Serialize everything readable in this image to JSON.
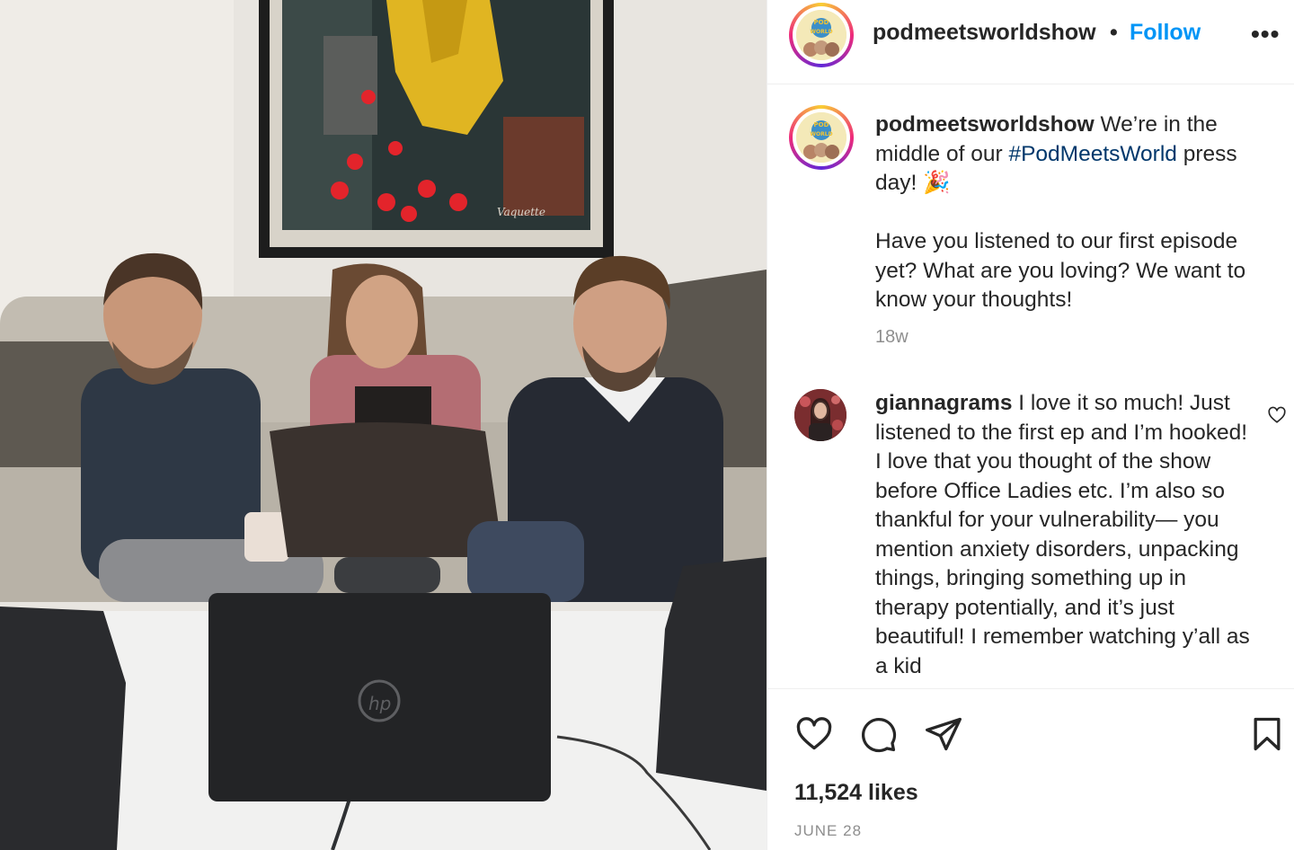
{
  "post": {
    "username": "podmeetsworldshow",
    "separator": "•",
    "follow_label": "Follow",
    "more_label": "•••",
    "avatar_text_top": "POD",
    "avatar_text_bottom": "WORLD"
  },
  "photo": {
    "painting_signature": "Vaquette"
  },
  "caption": {
    "username": "podmeetsworldshow",
    "text_1": " We’re in the middle of our ",
    "hashtag": "#PodMeetsWorld",
    "text_2": " press day! 🎉",
    "text_3": "Have you listened to our first episode yet? What are you loving? We want to know your thoughts!",
    "time": "18w"
  },
  "comment": {
    "username": "giannagrams",
    "text": " I love it so much! Just listened to the first ep and I’m hooked! I love that you thought of the show before Office Ladies etc. I’m also so thankful for your vulnerability— you mention anxiety disorders, unpacking things, bringing something up in therapy potentially, and it’s just beautiful! I remember watching y’all as a kid"
  },
  "actions": {
    "likes": "11,524 likes",
    "date": "JUNE 28"
  },
  "colors": {
    "accent": "#0095f6",
    "hashtag": "#00376b",
    "muted": "#8e8e8e",
    "text": "#262626"
  }
}
